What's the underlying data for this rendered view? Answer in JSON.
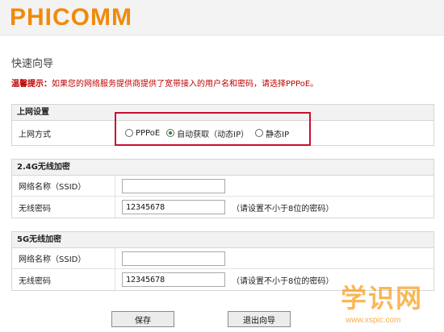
{
  "brand": {
    "logo_text": "PHICOMM",
    "accent": "#f08a0c"
  },
  "page": {
    "title": "快速向导",
    "tip_label": "温馨提示：",
    "tip_text": "如果您的网络服务提供商提供了宽带接入的用户名和密码，请选择PPPoE。"
  },
  "internet": {
    "heading": "上网设置",
    "mode_label": "上网方式",
    "options": [
      {
        "label": "PPPoE",
        "checked": false
      },
      {
        "label": "自动获取（动态IP）",
        "checked": true
      },
      {
        "label": "静态IP",
        "checked": false
      }
    ],
    "highlight_color": "#c8102e"
  },
  "wifi24": {
    "heading": "2.4G无线加密",
    "ssid_label": "网络名称（SSID）",
    "ssid_value": "",
    "password_label": "无线密码",
    "password_value": "12345678",
    "password_hint": "（请设置不小于8位的密码）"
  },
  "wifi5": {
    "heading": "5G无线加密",
    "ssid_label": "网络名称（SSID）",
    "ssid_value": "",
    "password_label": "无线密码",
    "password_value": "12345678",
    "password_hint": "（请设置不小于8位的密码）"
  },
  "buttons": {
    "save": "保存",
    "exit": "退出向导"
  },
  "watermark": {
    "main": "学识网",
    "url": "www.xspic.com",
    "color": "#f7a020"
  }
}
